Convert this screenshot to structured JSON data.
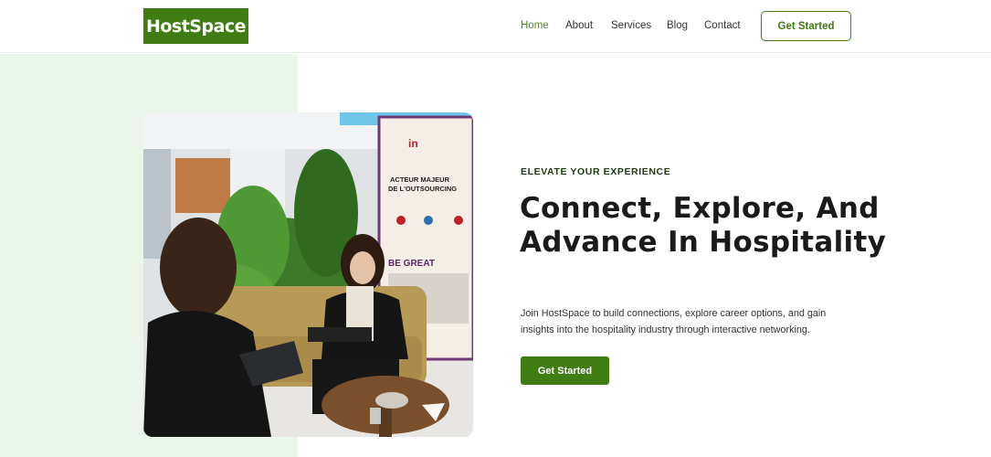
{
  "brand": {
    "name": "HostSpace"
  },
  "nav": {
    "items": [
      {
        "label": "Home",
        "active": true
      },
      {
        "label": "About",
        "active": false
      },
      {
        "label": "Services",
        "active": false
      },
      {
        "label": "Blog",
        "active": false
      },
      {
        "label": "Contact",
        "active": false
      }
    ],
    "cta_label": "Get Started"
  },
  "hero": {
    "eyebrow": "ELEVATE YOUR EXPERIENCE",
    "headline": "Connect, Explore, And Advance In Hospitality",
    "description": "Join HostSpace to build connections, explore career options, and gain insights into the hospitality industry through interactive networking.",
    "cta_label": "Get Started",
    "banner": {
      "brand": "in",
      "line1": "ACTEUR MAJEUR",
      "line2": "DE L'OUTSOURCING",
      "slogan": "BE GREAT"
    }
  },
  "colors": {
    "brand": "#3f7d12",
    "hero_bg": "#eaf6e9",
    "active_nav": "#4b8a1d"
  }
}
